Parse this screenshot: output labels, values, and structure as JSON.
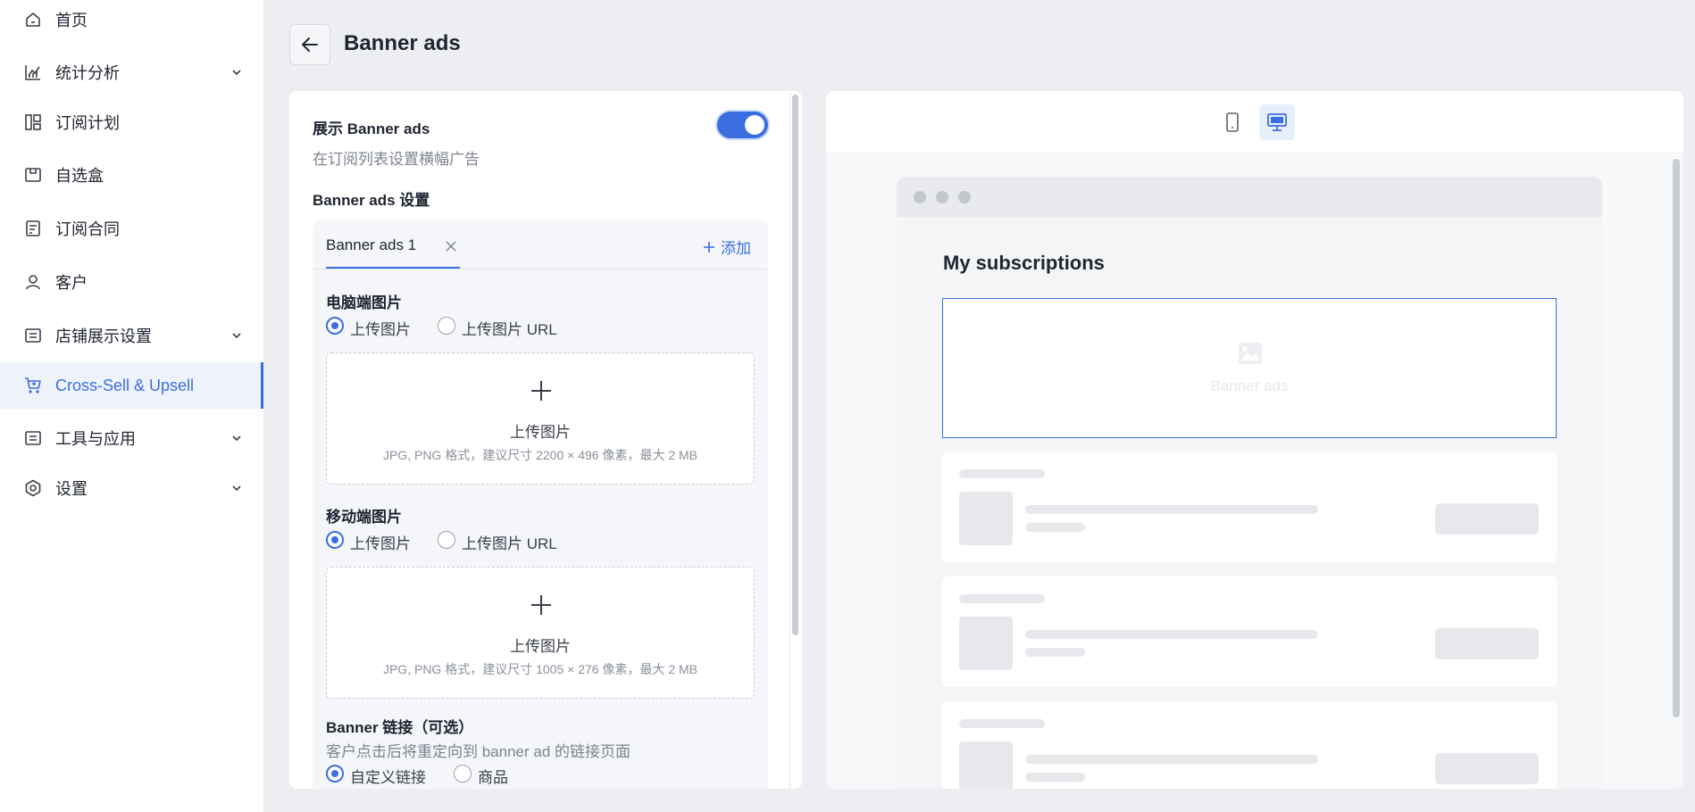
{
  "sidebar": {
    "items": [
      {
        "label": "首页",
        "icon": "home-icon"
      },
      {
        "label": "统计分析",
        "icon": "chart-icon"
      },
      {
        "label": "订阅计划",
        "icon": "plan-icon"
      },
      {
        "label": "自选盒",
        "icon": "box-icon"
      },
      {
        "label": "订阅合同",
        "icon": "contract-icon"
      },
      {
        "label": "客户",
        "icon": "user-icon"
      },
      {
        "label": "店铺展示设置",
        "icon": "store-display-icon"
      },
      {
        "label": "Cross-Sell & Upsell",
        "icon": "cart-icon"
      },
      {
        "label": "工具与应用",
        "icon": "tools-icon"
      },
      {
        "label": "设置",
        "icon": "settings-icon"
      }
    ],
    "active_item": "Cross-Sell & Upsell",
    "accent_color": "#3b6fe0"
  },
  "header": {
    "title": "Banner ads",
    "back_icon": "arrow-left-icon"
  },
  "settings": {
    "show_label": "展示 Banner ads",
    "show_desc": "在订阅列表设置横幅广告",
    "show_enabled": true,
    "section_title": "Banner ads 设置",
    "tab_label": "Banner ads 1",
    "add_label": "添加",
    "desktop": {
      "title": "电脑端图片",
      "option_upload": "上传图片",
      "option_url": "上传图片 URL",
      "upload_title": "上传图片",
      "upload_hint": "JPG, PNG 格式，建议尺寸 2200 × 496 像素，最大 2 MB"
    },
    "mobile": {
      "title": "移动端图片",
      "option_upload": "上传图片",
      "option_url": "上传图片 URL",
      "upload_title": "上传图片",
      "upload_hint": "JPG, PNG 格式，建议尺寸 1005 × 276 像素，最大 2 MB"
    },
    "link": {
      "title": "Banner 链接（可选）",
      "desc": "客户点击后将重定向到 banner ad 的链接页面",
      "option_custom": "自定义链接",
      "option_product": "商品"
    }
  },
  "preview": {
    "active_device": "desktop",
    "page_title": "My subscriptions",
    "banner_placeholder": "Banner ads"
  }
}
